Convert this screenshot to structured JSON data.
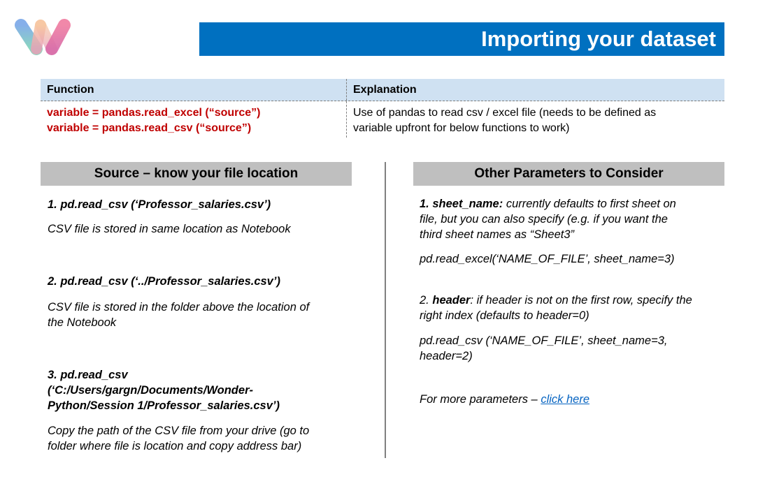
{
  "title": "Importing your dataset",
  "table": {
    "headers": [
      "Function",
      "Explanation"
    ],
    "functions": [
      "variable = pandas.read_excel (“source”)",
      "variable = pandas.read_csv (“source”)"
    ],
    "explanation": [
      "Use of pandas to read csv / excel file (needs to be defined as",
      "variable upfront for below functions to work)"
    ]
  },
  "left": {
    "heading": "Source – know your file location",
    "item1_code": "1. pd.read_csv (‘Professor_salaries.csv’)",
    "item1_desc": "CSV file is stored in same location as Notebook",
    "item2_code": "2. pd.read_csv (‘../Professor_salaries.csv’)",
    "item2_desc": [
      "CSV file is stored in the folder above the location of",
      "the Notebook"
    ],
    "item3_code": [
      "3. pd.read_csv",
      "(‘C:/Users/gargn/Documents/Wonder-",
      "Python/Session 1/Professor_salaries.csv’)"
    ],
    "item3_desc": [
      "Copy the path of the CSV file from your drive (go to",
      "folder where file is location and copy address bar)"
    ]
  },
  "right": {
    "heading": "Other Parameters to Consider",
    "p1_label": "1. sheet_name:",
    "p1_text": [
      " currently defaults to first sheet on",
      "file, but you can also specify (e.g. if you want the",
      "third sheet names as “Sheet3”"
    ],
    "p1_code": "pd.read_excel(‘NAME_OF_FILE’, sheet_name=3)",
    "p2_prefix": "2. ",
    "p2_label": "header",
    "p2_text": [
      ": if header is not on the first row, specify the",
      "right index (defaults to header=0)"
    ],
    "p2_code": [
      "pd.read_csv (‘NAME_OF_FILE’, sheet_name=3,",
      "header=2)"
    ],
    "more_text": "For more parameters – ",
    "more_link": "click here"
  },
  "colors": {
    "title_bg": "#0070c0",
    "table_header_bg": "#cfe1f2",
    "function_text": "#c00000",
    "section_bg": "#bfbfbf",
    "link": "#0563c1"
  }
}
